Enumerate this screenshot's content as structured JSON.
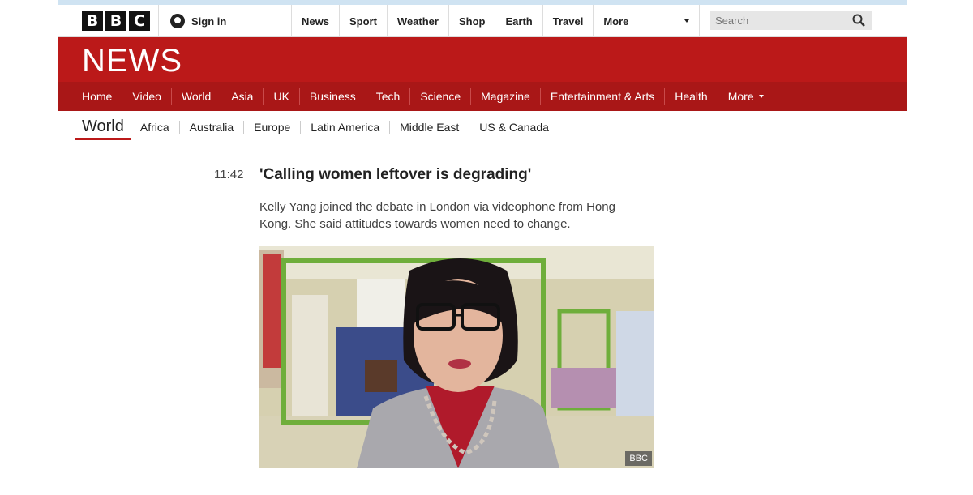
{
  "global": {
    "logo_letters": [
      "B",
      "B",
      "C"
    ],
    "signin_label": "Sign in",
    "nav": [
      "News",
      "Sport",
      "Weather",
      "Shop",
      "Earth",
      "Travel"
    ],
    "more_label": "More",
    "search_placeholder": "Search"
  },
  "banner": {
    "title": "NEWS"
  },
  "news_nav": {
    "items": [
      "Home",
      "Video",
      "World",
      "Asia",
      "UK",
      "Business",
      "Tech",
      "Science",
      "Magazine",
      "Entertainment & Arts",
      "Health"
    ],
    "active": "World",
    "more_label": "More"
  },
  "sub_nav": {
    "current": "World",
    "items": [
      "Africa",
      "Australia",
      "Europe",
      "Latin America",
      "Middle East",
      "US & Canada"
    ]
  },
  "story": {
    "time": "11:42",
    "headline": "'Calling women leftover is degrading'",
    "summary": "Kelly Yang joined the debate in London via videophone from Hong Kong. She said attitudes towards women need to change.",
    "video_badge": "BBC"
  },
  "colors": {
    "brand_red": "#bb1919",
    "nav_red": "#a91717"
  }
}
